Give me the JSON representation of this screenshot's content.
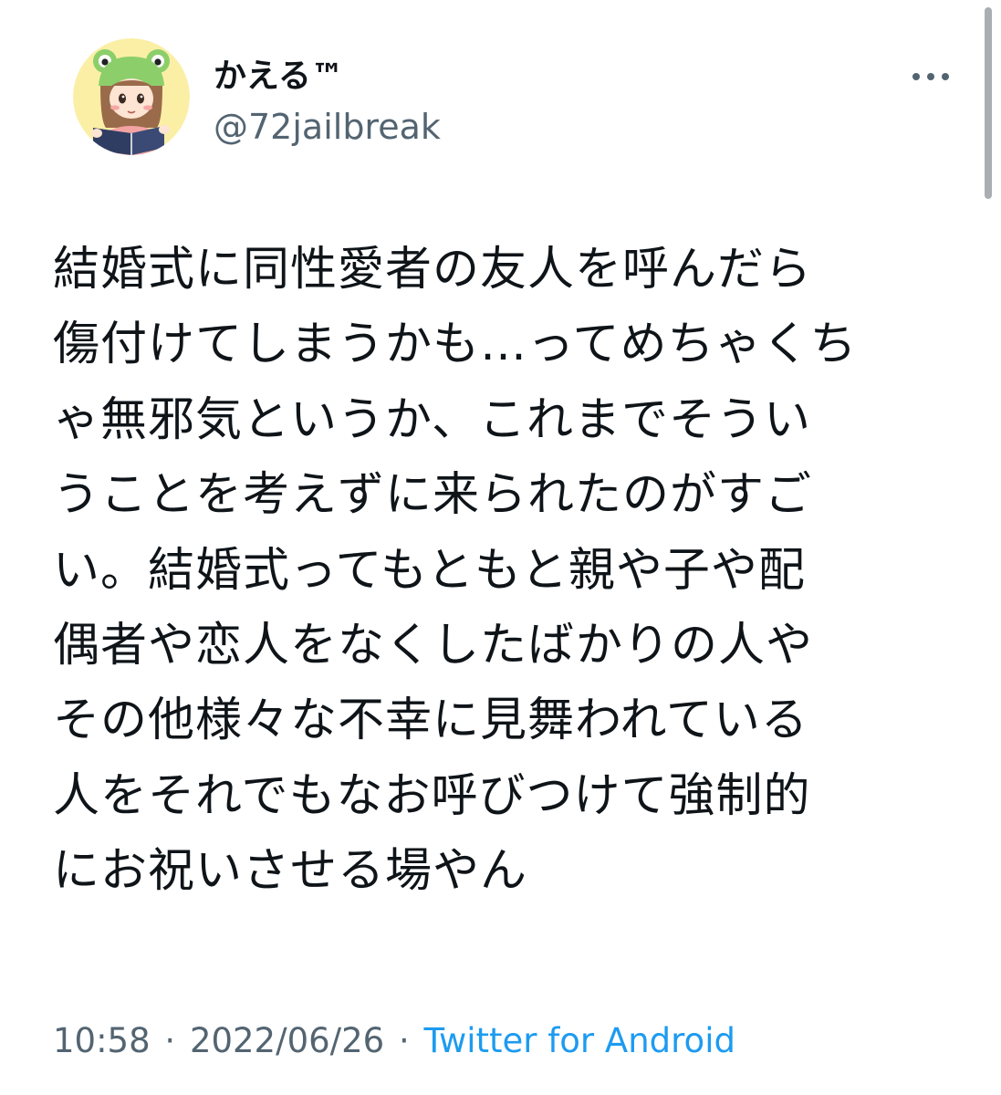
{
  "tweet": {
    "author": {
      "display_name": "かえる™",
      "handle": "@72jailbreak",
      "avatar_icon": "frog-hat-girl-avatar-icon"
    },
    "more_icon": "more-horizontal-icon",
    "text_lines": [
      "結婚式に同性愛者の友人を呼んだら",
      "傷付けてしまうかも…ってめちゃくち",
      "ゃ無邪気というか、これまでそうい",
      "うことを考えずに来られたのがすご",
      "い。結婚式ってもともと親や子や配",
      "偶者や恋人をなくしたばかりの人や",
      "その他様々な不幸に見舞われている",
      "人をそれでもなお呼びつけて強制的",
      "にお祝いさせる場やん"
    ],
    "time": "10:58",
    "separator": "·",
    "date": "2022/06/26",
    "source": "Twitter for Android"
  },
  "colors": {
    "text": "#0f1419",
    "secondary": "#536471",
    "link": "#1d9bf0",
    "avatar_background": "#fbefa6"
  }
}
